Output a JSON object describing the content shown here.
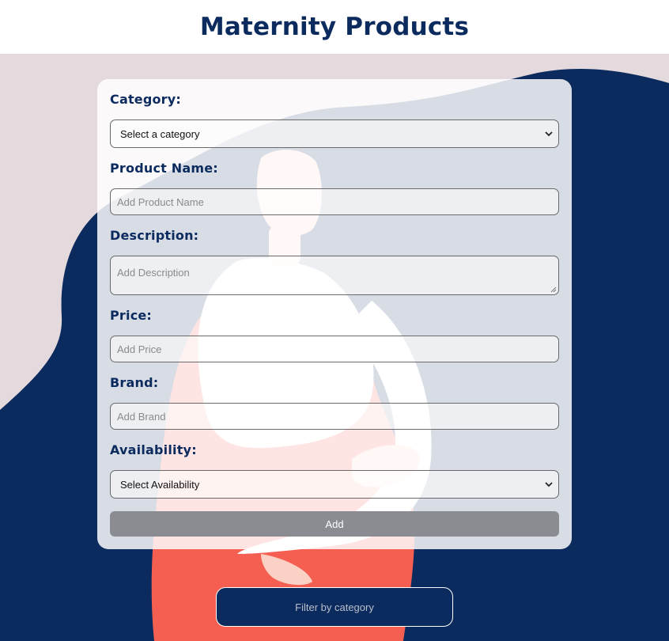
{
  "header": {
    "title": "Maternity Products"
  },
  "form": {
    "category": {
      "label": "Category:",
      "selected": "Select a category"
    },
    "product_name": {
      "label": "Product Name:",
      "placeholder": "Add Product Name"
    },
    "description": {
      "label": "Description:",
      "placeholder": "Add Description"
    },
    "price": {
      "label": "Price:",
      "placeholder": "Add Price"
    },
    "brand": {
      "label": "Brand:",
      "placeholder": "Add Brand"
    },
    "availability": {
      "label": "Availability:",
      "selected": "Select Availability"
    },
    "add_label": "Add"
  },
  "filter": {
    "label": "Filter by category"
  },
  "colors": {
    "navy": "#0b2a5e",
    "background_pink": "#e4dadd",
    "coral": "#f45f52",
    "button_gray": "#8a8c92"
  }
}
